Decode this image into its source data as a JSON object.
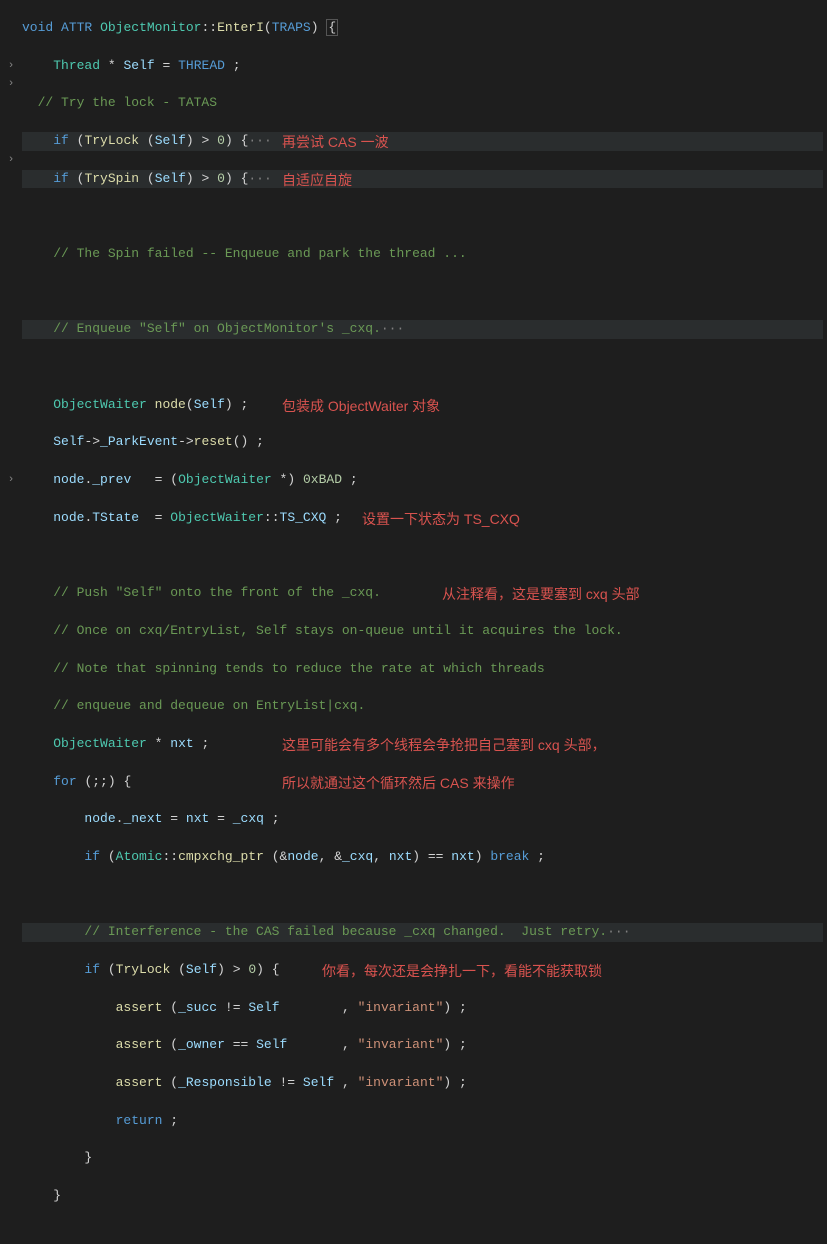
{
  "code": {
    "l1_void": "void",
    "l1_attr": "ATTR",
    "l1_class": "ObjectMonitor",
    "l1_fn": "EnterI",
    "l1_traps": "TRAPS",
    "l2_thread": "Thread",
    "l2_self": "Self",
    "l2_threadm": "THREAD",
    "l3_cmt": "  // Try the lock - TATAS",
    "l4_if": "if",
    "l4_try": "TryLock",
    "l4_self": "Self",
    "l4_num": "0",
    "l5_if": "if",
    "l5_try": "TrySpin",
    "l5_self": "Self",
    "l5_num": "0",
    "l7_cmt": "// The Spin failed -- Enqueue and park the thread ...",
    "l9_cmt": "// Enqueue \"Self\" on ObjectMonitor's _cxq.",
    "l11_ow": "ObjectWaiter",
    "l11_node": "node",
    "l11_self": "Self",
    "l12_self": "Self",
    "l12_park": "_ParkEvent",
    "l12_reset": "reset",
    "l13_node": "node",
    "l13_prev": "_prev",
    "l13_ow": "ObjectWaiter",
    "l13_hex": "0xBAD",
    "l14_node": "node",
    "l14_ts": "TState",
    "l14_ow": "ObjectWaiter",
    "l14_cxq": "TS_CXQ",
    "l16_cmt": "// Push \"Self\" onto the front of the _cxq.",
    "l17_cmt": "// Once on cxq/EntryList, Self stays on-queue until it acquires the lock.",
    "l18_cmt": "// Note that spinning tends to reduce the rate at which threads",
    "l19_cmt": "// enqueue and dequeue on EntryList|cxq.",
    "l20_ow": "ObjectWaiter",
    "l20_nxt": "nxt",
    "l21_for": "for",
    "l22_node": "node",
    "l22_next": "_next",
    "l22_nxt": "nxt",
    "l22_cxq": "_cxq",
    "l23_if": "if",
    "l23_atomic": "Atomic",
    "l23_fn": "cmpxchg_ptr",
    "l23_node": "node",
    "l23_cxq": "_cxq",
    "l23_nxt": "nxt",
    "l23_nxt2": "nxt",
    "l23_break": "break",
    "l25_cmt": "// Interference - the CAS failed because _cxq changed.  Just retry.",
    "l26_if": "if",
    "l26_try": "TryLock",
    "l26_self": "Self",
    "l26_num": "0",
    "l27_assert": "assert",
    "l27_succ": "_succ",
    "l27_self": "Self",
    "l27_str": "\"invariant\"",
    "l28_assert": "assert",
    "l28_owner": "_owner",
    "l28_self": "Self",
    "l28_str": "\"invariant\"",
    "l29_assert": "assert",
    "l29_resp": "_Responsible",
    "l29_self": "Self",
    "l29_str": "\"invariant\"",
    "l30_return": "return",
    "dots": "···"
  },
  "annotations": {
    "a1": "再尝试 CAS 一波",
    "a2": "自适应自旋",
    "a3": "包装成 ObjectWaiter 对象",
    "a4": "设置一下状态为 TS_CXQ",
    "a5": "从注释看，这是要塞到 cxq 头部",
    "a6": "这里可能会有多个线程会争抢把自己塞到 cxq 头部，",
    "a7": "所以就通过这个循环然后 CAS 来操作",
    "a8": "你看，每次还是会挣扎一下，看能不能获取锁"
  },
  "fold_icon": "›"
}
